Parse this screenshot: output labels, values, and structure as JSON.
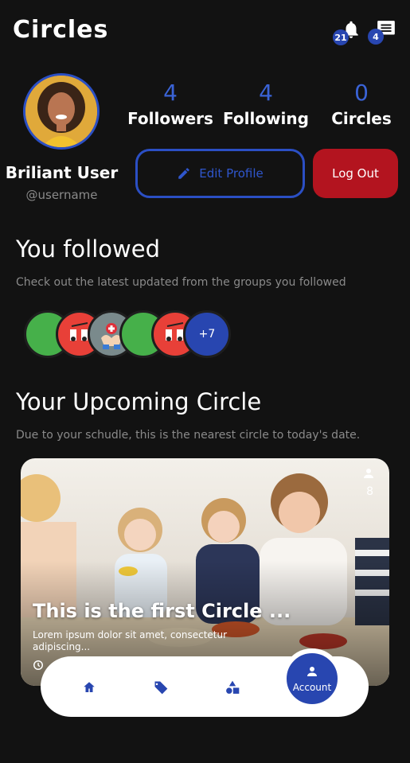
{
  "header": {
    "title": "Circles",
    "notifications_count": "21",
    "messages_count": "4"
  },
  "profile": {
    "name": "Briliant User",
    "handle": "@username",
    "stats": [
      {
        "value": "4",
        "label": "Followers"
      },
      {
        "value": "4",
        "label": "Following"
      },
      {
        "value": "0",
        "label": "Circles"
      }
    ],
    "edit_label": "Edit Profile",
    "logout_label": "Log Out"
  },
  "followed": {
    "title": "You followed",
    "subtitle": "Check out the latest updated from the groups you followed",
    "more_label": "+7"
  },
  "upcoming": {
    "title": "Your Upcoming Circle",
    "subtitle": "Due to your schudle, this is the nearest circle to today's date.",
    "card": {
      "title": "This is the first Circle ...",
      "description": "Lorem ipsum dolor sit amet, consectetur adipiscing...",
      "member_count": "8"
    }
  },
  "nav": {
    "items": [
      "home-icon",
      "tag-icon",
      "shapes-icon"
    ],
    "active_label": "Account"
  },
  "colors": {
    "accent": "#2846b0",
    "danger": "#b3141f",
    "background": "#121212"
  }
}
